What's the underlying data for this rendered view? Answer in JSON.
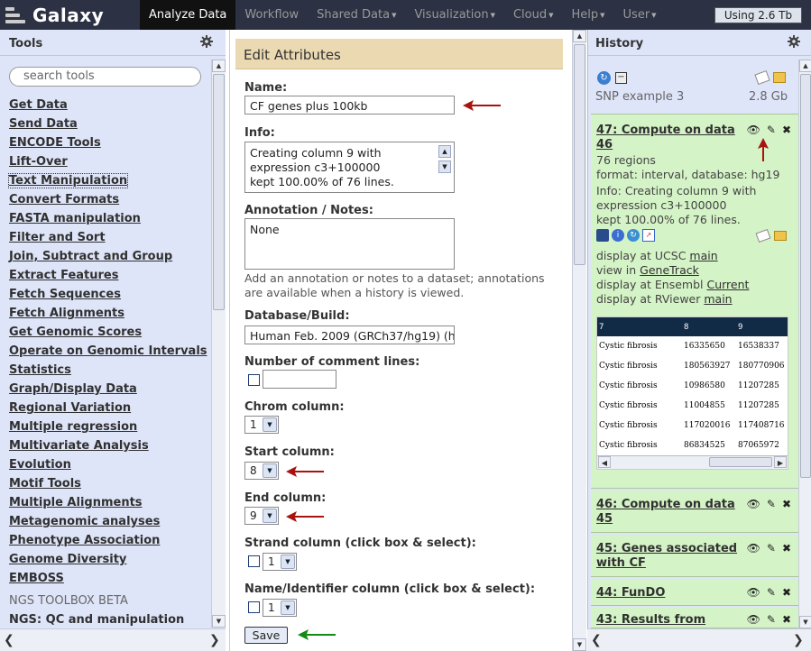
{
  "brand": "Galaxy",
  "nav": [
    {
      "label": "Analyze Data",
      "active": true,
      "menu": false
    },
    {
      "label": "Workflow",
      "active": false,
      "menu": false
    },
    {
      "label": "Shared Data",
      "active": false,
      "menu": true
    },
    {
      "label": "Visualization",
      "active": false,
      "menu": true
    },
    {
      "label": "Cloud",
      "active": false,
      "menu": true
    },
    {
      "label": "Help",
      "active": false,
      "menu": true
    },
    {
      "label": "User",
      "active": false,
      "menu": true
    }
  ],
  "usage": "Using 2.6 Tb",
  "tools_panel": {
    "title": "Tools",
    "search_placeholder": "search tools",
    "items": [
      "Get Data",
      "Send Data",
      "ENCODE Tools",
      "Lift-Over",
      "Text Manipulation",
      "Convert Formats",
      "FASTA manipulation",
      "Filter and Sort",
      "Join, Subtract and Group",
      "Extract Features",
      "Fetch Sequences",
      "Fetch Alignments",
      "Get Genomic Scores",
      "Operate on Genomic Intervals",
      "Statistics",
      "Graph/Display Data",
      "Regional Variation",
      "Multiple regression",
      "Multivariate Analysis",
      "Evolution",
      "Motif Tools",
      "Multiple Alignments",
      "Metagenomic analyses",
      "Phenotype Association",
      "Genome Diversity",
      "EMBOSS"
    ],
    "section": "NGS TOOLBOX BETA",
    "section_item": "NGS: QC and manipulation"
  },
  "form": {
    "title": "Edit Attributes",
    "name_label": "Name:",
    "name_value": "CF genes plus 100kb",
    "info_label": "Info:",
    "info_lines": [
      "Creating column 9 with",
      "expression c3+100000",
      "kept 100.00% of 76 lines."
    ],
    "annotation_label": "Annotation / Notes:",
    "annotation_value": "None",
    "annotation_help_1": "Add an annotation or notes to a dataset; annotations",
    "annotation_help_2": "are available when a history is viewed.",
    "dbkey_label": "Database/Build:",
    "dbkey_value": "Human Feb. 2009 (GRCh37/hg19) (h",
    "comment_label": "Number of comment lines:",
    "comment_value": "",
    "chrom_label": "Chrom column:",
    "chrom_value": "1",
    "start_label": "Start column:",
    "start_value": "8",
    "end_label": "End column:",
    "end_value": "9",
    "strand_label": "Strand column (click box & select):",
    "strand_value": "1",
    "name_col_label": "Name/Identifier column (click box & select):",
    "name_col_value": "1",
    "save_label": "Save"
  },
  "history": {
    "title": "History",
    "name": "SNP example 3",
    "size": "2.8 Gb",
    "current": {
      "title_1": "47: Compute on data",
      "title_2": "46",
      "regions": "76 regions",
      "format": "format: interval, database: hg19",
      "info_1": "Info: Creating column 9 with",
      "info_2": "expression c3+100000",
      "info_3": "kept 100.00% of 76 lines.",
      "ucsc_prefix": "display at UCSC ",
      "ucsc_link": "main",
      "genetrack_prefix": "view in ",
      "genetrack_link": "GeneTrack",
      "ensembl_prefix": "display at Ensembl ",
      "ensembl_link": "Current",
      "rviewer_prefix": "display at RViewer ",
      "rviewer_link": "main",
      "peek_headers": [
        "7",
        "8",
        "9"
      ],
      "peek_rows": [
        [
          "Cystic fibrosis",
          "16335650",
          "16538337"
        ],
        [
          "Cystic fibrosis",
          "180563927",
          "180770906"
        ],
        [
          "Cystic fibrosis",
          "10986580",
          "11207285"
        ],
        [
          "Cystic fibrosis",
          "11004855",
          "11207285"
        ],
        [
          "Cystic fibrosis",
          "117020016",
          "117408716"
        ],
        [
          "Cystic fibrosis",
          "86834525",
          "87065972"
        ]
      ]
    },
    "others": [
      {
        "line1": "46: Compute on data",
        "line2": "45"
      },
      {
        "line1": "45: Genes associated",
        "line2": "with CF"
      },
      {
        "line1": "44: FunDO",
        "line2": ""
      },
      {
        "line1": "43: Results from",
        "line2": ""
      }
    ]
  },
  "colors": {
    "masthead": "#2c3143",
    "side_panel": "#dfe5f9",
    "form_title": "#ebd9b2",
    "history_ok": "#d4f3c6",
    "arrow_red": "#a8130f",
    "arrow_green": "#138a13"
  }
}
